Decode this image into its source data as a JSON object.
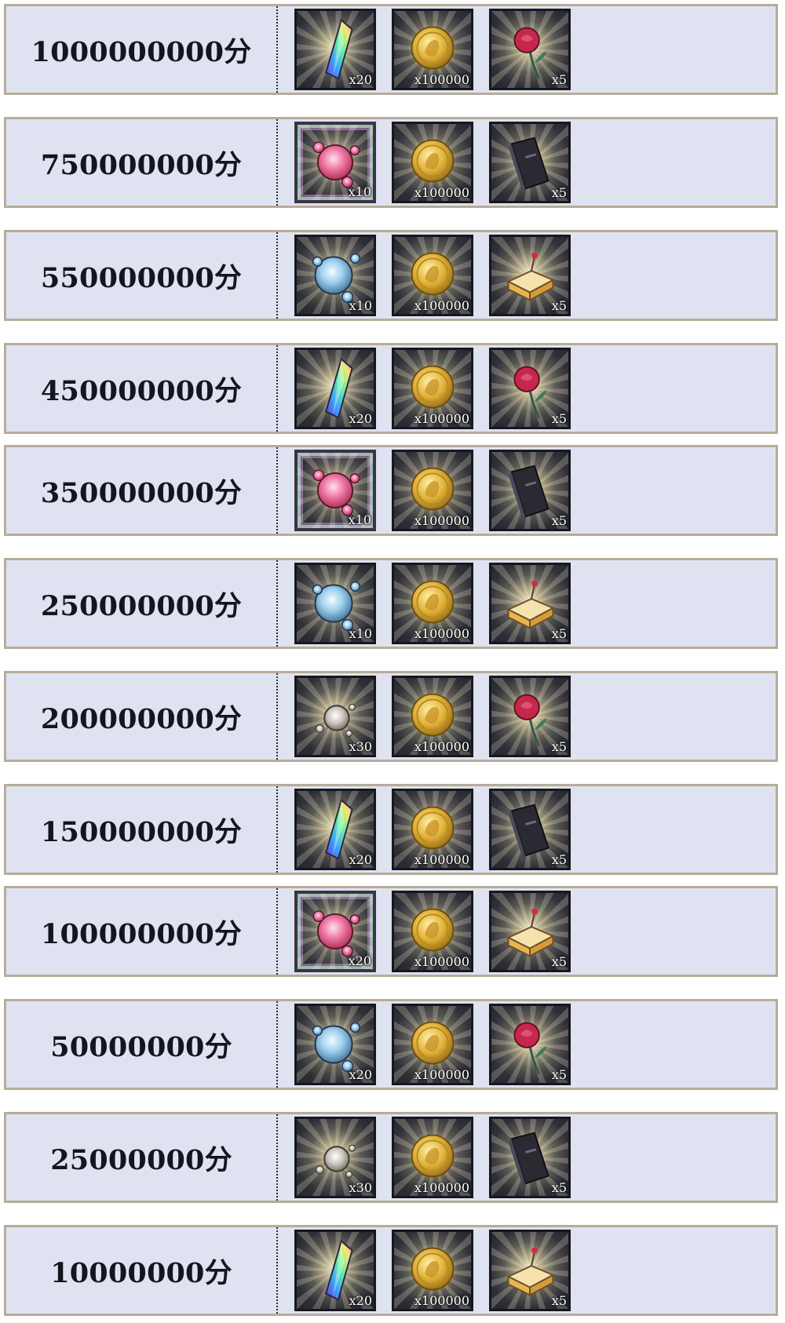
{
  "rows": [
    {
      "score": "1000000000分",
      "rewards": [
        {
          "item": "crystal",
          "qty": "x20"
        },
        {
          "item": "coin",
          "qty": "x100000"
        },
        {
          "item": "rose",
          "qty": "x5"
        }
      ]
    },
    {
      "score": "750000000分",
      "rewards": [
        {
          "item": "pink-orb",
          "qty": "x10"
        },
        {
          "item": "coin",
          "qty": "x100000"
        },
        {
          "item": "book",
          "qty": "x5"
        }
      ]
    },
    {
      "score": "550000000分",
      "rewards": [
        {
          "item": "blue-orb",
          "qty": "x10"
        },
        {
          "item": "coin",
          "qty": "x100000"
        },
        {
          "item": "cake",
          "qty": "x5"
        }
      ]
    },
    {
      "score": "450000000分",
      "rewards": [
        {
          "item": "crystal",
          "qty": "x20"
        },
        {
          "item": "coin",
          "qty": "x100000"
        },
        {
          "item": "rose",
          "qty": "x5"
        }
      ]
    },
    {
      "score": "350000000分",
      "rewards": [
        {
          "item": "pink-orb",
          "qty": "x10"
        },
        {
          "item": "coin",
          "qty": "x100000"
        },
        {
          "item": "book",
          "qty": "x5"
        }
      ]
    },
    {
      "score": "250000000分",
      "rewards": [
        {
          "item": "blue-orb",
          "qty": "x10"
        },
        {
          "item": "coin",
          "qty": "x100000"
        },
        {
          "item": "cake",
          "qty": "x5"
        }
      ]
    },
    {
      "score": "200000000分",
      "rewards": [
        {
          "item": "silver-orb",
          "qty": "x30"
        },
        {
          "item": "coin",
          "qty": "x100000"
        },
        {
          "item": "rose",
          "qty": "x5"
        }
      ]
    },
    {
      "score": "150000000分",
      "rewards": [
        {
          "item": "crystal",
          "qty": "x20"
        },
        {
          "item": "coin",
          "qty": "x100000"
        },
        {
          "item": "book",
          "qty": "x5"
        }
      ]
    },
    {
      "score": "100000000分",
      "rewards": [
        {
          "item": "pink-orb",
          "qty": "x20"
        },
        {
          "item": "coin",
          "qty": "x100000"
        },
        {
          "item": "cake",
          "qty": "x5"
        }
      ]
    },
    {
      "score": "50000000分",
      "rewards": [
        {
          "item": "blue-orb",
          "qty": "x20"
        },
        {
          "item": "coin",
          "qty": "x100000"
        },
        {
          "item": "rose",
          "qty": "x5"
        }
      ]
    },
    {
      "score": "25000000分",
      "rewards": [
        {
          "item": "silver-orb",
          "qty": "x30"
        },
        {
          "item": "coin",
          "qty": "x100000"
        },
        {
          "item": "book",
          "qty": "x5"
        }
      ]
    },
    {
      "score": "10000000分",
      "rewards": [
        {
          "item": "crystal",
          "qty": "x20"
        },
        {
          "item": "coin",
          "qty": "x100000"
        },
        {
          "item": "cake",
          "qty": "x5"
        }
      ]
    }
  ]
}
